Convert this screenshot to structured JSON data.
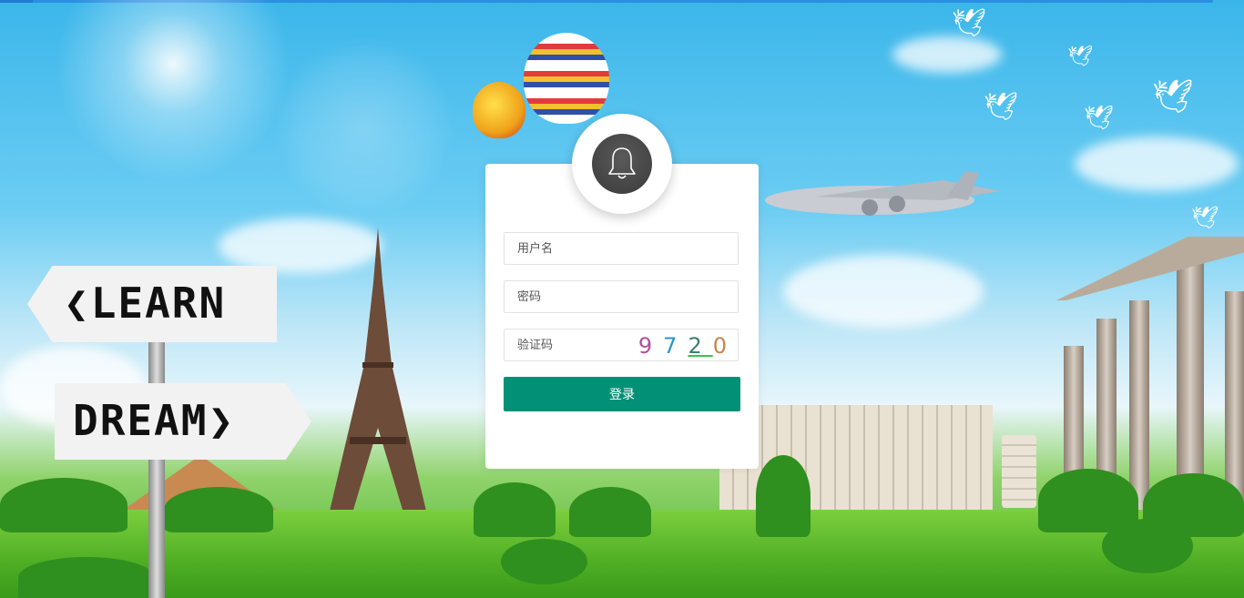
{
  "background": {
    "signs": {
      "learn": "LEARN",
      "dream": "DREAM"
    }
  },
  "login": {
    "username_placeholder": "用户名",
    "password_placeholder": "密码",
    "captcha_placeholder": "验证码",
    "captcha_digits": [
      "9",
      "7",
      "2",
      "0"
    ],
    "submit_label": "登录",
    "accent_color": "#029177"
  },
  "icons": {
    "avatar": "bell-icon"
  }
}
